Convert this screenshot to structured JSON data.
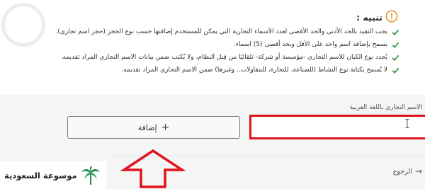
{
  "notice": {
    "title": "تنبيه :",
    "rules": [
      "يجب التقيد بالحد الأدنى والحد الأقصى لعدد الأسماء التجارية التي يمكن للمستخدم إضافتها حسب نوع الحجز (حجز اسم تجاري).",
      "يسمح بإضافة اسم واحد على الأقل وبحد أقصى (5) اسماء.",
      "يُحدد نوع الكيان للاسم التجاري -مؤسسة أو شركة- تلقائيًا من قِبل النظام، ولا يُكتب ضمن بيانات الاسم التجاري المراد تقديمه.",
      "لا يُسمح بكتابة نوع النشاط (للصناعة، للتجارة، للمقاولات.. وغيرها) ضمن الاسم التجاري المراد تقديمه."
    ]
  },
  "form": {
    "arabic_name_label": "الاسم التجاري باللغة العربية",
    "arabic_name_value": "",
    "add_button_label": "إضافة",
    "add_button_icon": "plus-icon"
  },
  "navigation": {
    "back_label": "الرجوع"
  },
  "brand": {
    "name": "موسوعة السعودية",
    "logo": "palm-logo"
  },
  "colors": {
    "highlight": "#e0121b",
    "check": "#2e9c4a",
    "notice_icon": "#e09b2d",
    "brand_green": "#1f8a4c"
  }
}
